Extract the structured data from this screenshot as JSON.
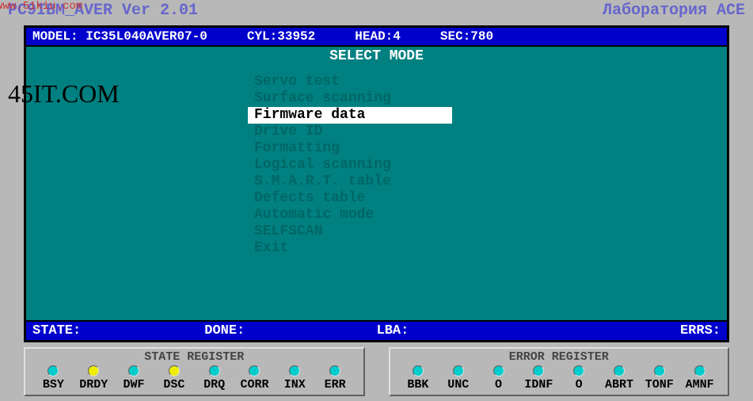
{
  "header": {
    "app_name": "PC9IBM_AVER",
    "version_label": "Ver 2.01",
    "lab_label": "Лаборатория ACE"
  },
  "watermarks": {
    "url": "www.51kiu.com",
    "site": "45IT.COM"
  },
  "info": {
    "model_label": "MODEL:",
    "model_value": "IC35L040AVER07-0",
    "cyl_label": "CYL:",
    "cyl_value": "33952",
    "head_label": "HEAD:",
    "head_value": "4",
    "sec_label": "SEC:",
    "sec_value": "780"
  },
  "menu": {
    "title": "SELECT MODE",
    "items": [
      "Servo test",
      "Surface scanning",
      "Firmware data",
      "Drive ID",
      "Formatting",
      "Logical scanning",
      "S.M.A.R.T. table",
      "Defects table",
      "Automatic mode",
      "SELFSCAN",
      "Exit"
    ],
    "selected_index": 2
  },
  "status": {
    "state_label": "STATE:",
    "done_label": "DONE:",
    "lba_label": "LBA:",
    "errs_label": "ERRS:"
  },
  "state_register": {
    "title": "STATE REGISTER",
    "leds": [
      {
        "label": "BSY",
        "color": "cyan"
      },
      {
        "label": "DRDY",
        "color": "yellow"
      },
      {
        "label": "DWF",
        "color": "cyan"
      },
      {
        "label": "DSC",
        "color": "yellow"
      },
      {
        "label": "DRQ",
        "color": "cyan"
      },
      {
        "label": "CORR",
        "color": "cyan"
      },
      {
        "label": "INX",
        "color": "cyan"
      },
      {
        "label": "ERR",
        "color": "cyan"
      }
    ]
  },
  "error_register": {
    "title": "ERROR REGISTER",
    "leds": [
      {
        "label": "BBK",
        "color": "cyan"
      },
      {
        "label": "UNC",
        "color": "cyan"
      },
      {
        "label": "O",
        "color": "cyan"
      },
      {
        "label": "IDNF",
        "color": "cyan"
      },
      {
        "label": "O",
        "color": "cyan"
      },
      {
        "label": "ABRT",
        "color": "cyan"
      },
      {
        "label": "TONF",
        "color": "cyan"
      },
      {
        "label": "AMNF",
        "color": "cyan"
      }
    ]
  }
}
